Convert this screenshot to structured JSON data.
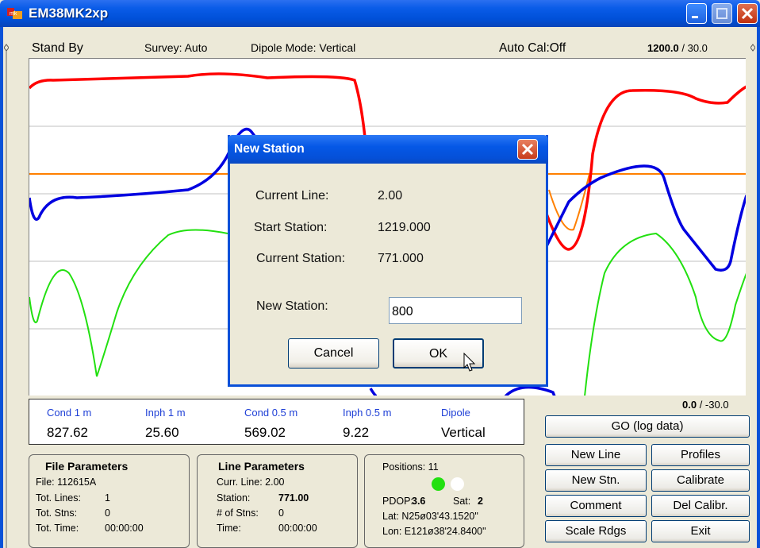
{
  "window": {
    "title": "EM38MK2xp",
    "app_icon": "em38-app-icon"
  },
  "status": {
    "state": "Stand By",
    "survey": "Survey: Auto",
    "dipole_mode": "Dipole Mode: Vertical",
    "auto_cal": "Auto Cal:Off",
    "scale_top_bold": "1200.0",
    "scale_top_rest": " / 30.0",
    "scale_bot_bold": "0.0",
    "scale_bot_rest": " / -30.0"
  },
  "readings": {
    "labels": [
      "Cond 1 m",
      "Inph 1 m",
      "Cond 0.5 m",
      "Inph 0.5 m",
      "Dipole"
    ],
    "values": [
      "827.62",
      "25.60",
      "569.02",
      "9.22",
      "Vertical"
    ]
  },
  "file_params": {
    "title": "File Parameters",
    "file": "File: 112615A",
    "lines_label": "Tot. Lines:",
    "lines_value": "1",
    "stns_label": "Tot. Stns:",
    "stns_value": "0",
    "time_label": "Tot. Time:",
    "time_value": "00:00:00"
  },
  "line_params": {
    "title": "Line Parameters",
    "curr_line": "Curr. Line: 2.00",
    "station_label": "Station:",
    "station_value": "771.00",
    "nstns_label": "# of Stns:",
    "nstns_value": "0",
    "time_label": "Time:",
    "time_value": "00:00:00"
  },
  "gps": {
    "positions": "Positions: 11",
    "pdop_label": "PDOP:",
    "pdop_value": "3.6",
    "sat_label": "Sat:",
    "sat_value": "2",
    "lat": "Lat:  N25ø03'43.1520\"",
    "lon": "Lon: E121ø38'24.8400\"",
    "indicator_colors": [
      "#22E010",
      "#FFFFFF"
    ]
  },
  "buttons": {
    "go": "GO (log data)",
    "new_line": "New Line",
    "profiles": "Profiles",
    "new_stn": "New Stn.",
    "calibrate": "Calibrate",
    "comment": "Comment",
    "del_calibr": "Del Calibr.",
    "scale_rdgs": "Scale Rdgs",
    "exit": "Exit"
  },
  "dialog": {
    "title": "New Station",
    "current_line_label": "Current Line:",
    "current_line_value": "2.00",
    "start_station_label": "Start Station:",
    "start_station_value": "1219.000",
    "current_station_label": "Current Station:",
    "current_station_value": "771.000",
    "new_station_label": "New Station:",
    "new_station_value": "800",
    "cancel": "Cancel",
    "ok": "OK"
  },
  "plot_colors": {
    "cond1": "#FF0000",
    "inph1": "#0000E0",
    "cond05": "#00E000",
    "inph05": "#FF8000",
    "grid": "#C0C0C0"
  }
}
